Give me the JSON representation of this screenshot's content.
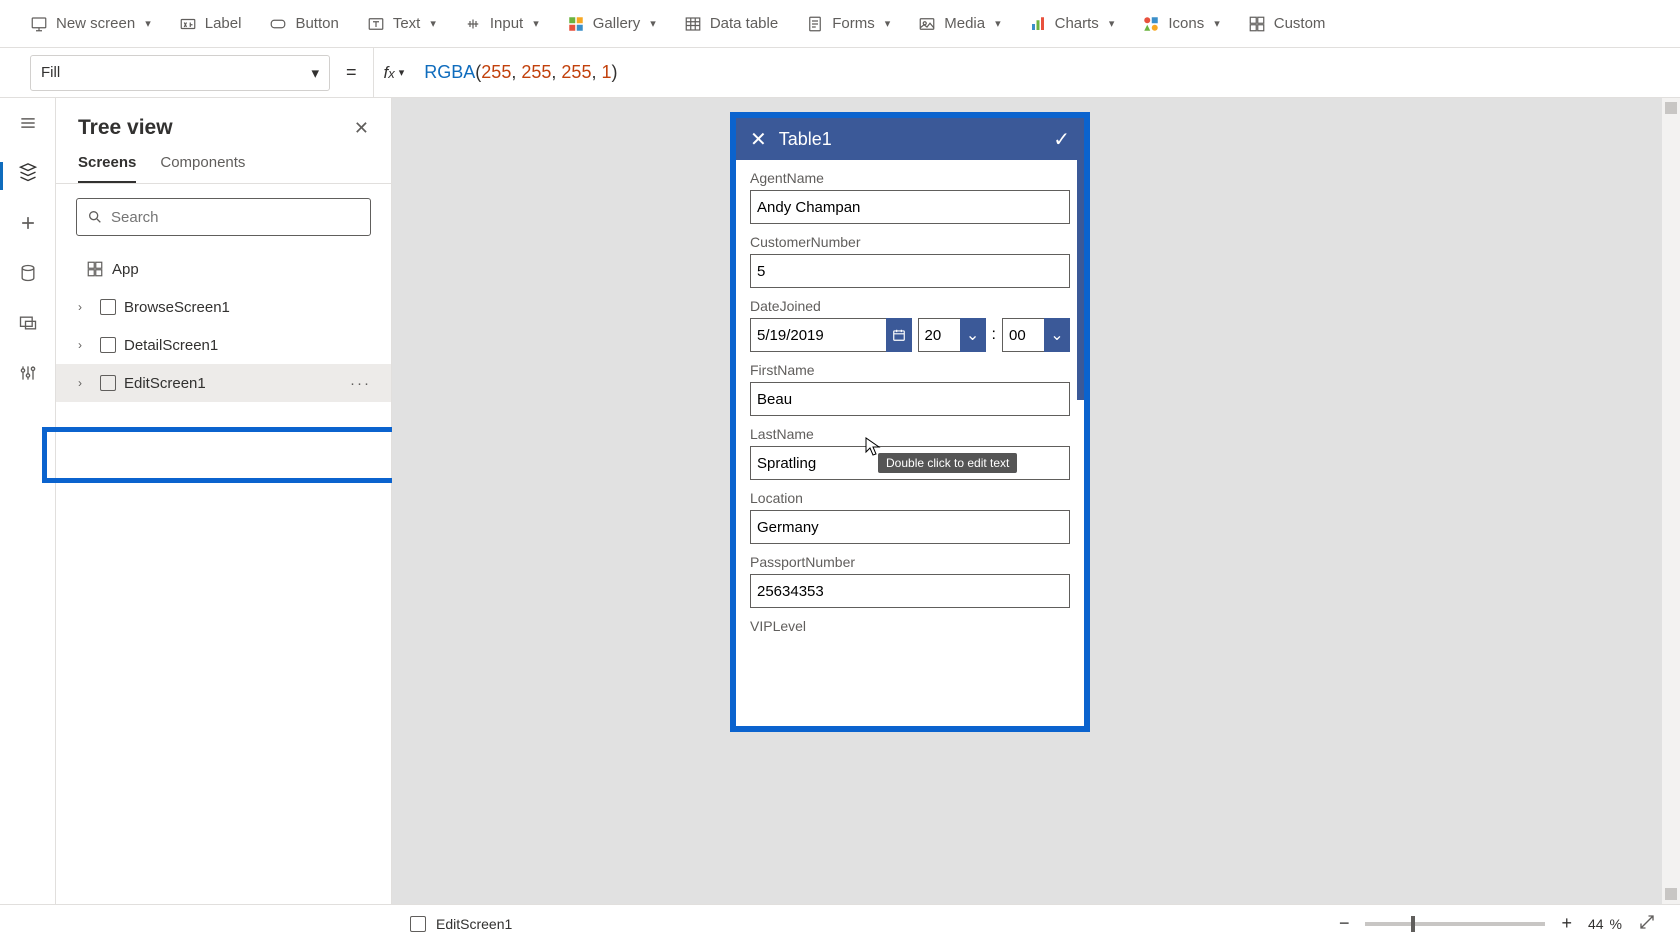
{
  "ribbon": {
    "newscreen": "New screen",
    "label": "Label",
    "button": "Button",
    "text": "Text",
    "input": "Input",
    "gallery": "Gallery",
    "datatable": "Data table",
    "forms": "Forms",
    "media": "Media",
    "charts": "Charts",
    "icons": "Icons",
    "custom": "Custom"
  },
  "formula": {
    "property": "Fill",
    "fn": "RGBA",
    "a1": "255",
    "a2": "255",
    "a3": "255",
    "a4": "1"
  },
  "tree": {
    "title": "Tree view",
    "tab_screens": "Screens",
    "tab_components": "Components",
    "search_ph": "Search",
    "app": "App",
    "n1": "BrowseScreen1",
    "n2": "DetailScreen1",
    "n3": "EditScreen1"
  },
  "phone": {
    "title": "Table1",
    "fields": {
      "agent_lbl": "AgentName",
      "agent_val": "Andy Champan",
      "cust_lbl": "CustomerNumber",
      "cust_val": "5",
      "date_lbl": "DateJoined",
      "date_val": "5/19/2019",
      "date_hh": "20",
      "date_mm": "00",
      "first_lbl": "FirstName",
      "first_val": "Beau",
      "last_lbl": "LastName",
      "last_val": "Spratling",
      "loc_lbl": "Location",
      "loc_val": "Germany",
      "pass_lbl": "PassportNumber",
      "pass_val": "25634353",
      "vip_lbl": "VIPLevel"
    },
    "tooltip": "Double click to edit text"
  },
  "status": {
    "screen": "EditScreen1",
    "zoom": "44",
    "pct": "%"
  }
}
